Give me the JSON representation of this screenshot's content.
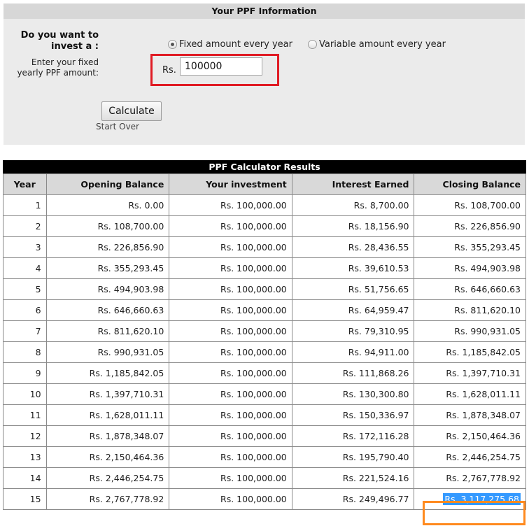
{
  "info": {
    "title": "Your PPF Information",
    "question_line1": "Do you want to",
    "question_line2": "invest a :",
    "option_fixed": "Fixed amount every year",
    "option_variable": "Variable amount every year",
    "amount_label_line1": "Enter your fixed",
    "amount_label_line2": "yearly PPF amount:",
    "currency_prefix": "Rs.",
    "amount_value": "100000",
    "calculate_label": "Calculate",
    "start_over_label": "Start Over"
  },
  "results": {
    "title": "PPF Calculator Results",
    "headers": [
      "Year",
      "Opening Balance",
      "Your investment",
      "Interest Earned",
      "Closing Balance"
    ],
    "rows": [
      [
        "1",
        "Rs. 0.00",
        "Rs. 100,000.00",
        "Rs. 8,700.00",
        "Rs. 108,700.00"
      ],
      [
        "2",
        "Rs. 108,700.00",
        "Rs. 100,000.00",
        "Rs. 18,156.90",
        "Rs. 226,856.90"
      ],
      [
        "3",
        "Rs. 226,856.90",
        "Rs. 100,000.00",
        "Rs. 28,436.55",
        "Rs. 355,293.45"
      ],
      [
        "4",
        "Rs. 355,293.45",
        "Rs. 100,000.00",
        "Rs. 39,610.53",
        "Rs. 494,903.98"
      ],
      [
        "5",
        "Rs. 494,903.98",
        "Rs. 100,000.00",
        "Rs. 51,756.65",
        "Rs. 646,660.63"
      ],
      [
        "6",
        "Rs. 646,660.63",
        "Rs. 100,000.00",
        "Rs. 64,959.47",
        "Rs. 811,620.10"
      ],
      [
        "7",
        "Rs. 811,620.10",
        "Rs. 100,000.00",
        "Rs. 79,310.95",
        "Rs. 990,931.05"
      ],
      [
        "8",
        "Rs. 990,931.05",
        "Rs. 100,000.00",
        "Rs. 94,911.00",
        "Rs. 1,185,842.05"
      ],
      [
        "9",
        "Rs. 1,185,842.05",
        "Rs. 100,000.00",
        "Rs. 111,868.26",
        "Rs. 1,397,710.31"
      ],
      [
        "10",
        "Rs. 1,397,710.31",
        "Rs. 100,000.00",
        "Rs. 130,300.80",
        "Rs. 1,628,011.11"
      ],
      [
        "11",
        "Rs. 1,628,011.11",
        "Rs. 100,000.00",
        "Rs. 150,336.97",
        "Rs. 1,878,348.07"
      ],
      [
        "12",
        "Rs. 1,878,348.07",
        "Rs. 100,000.00",
        "Rs. 172,116.28",
        "Rs. 2,150,464.36"
      ],
      [
        "13",
        "Rs. 2,150,464.36",
        "Rs. 100,000.00",
        "Rs. 195,790.40",
        "Rs. 2,446,254.75"
      ],
      [
        "14",
        "Rs. 2,446,254.75",
        "Rs. 100,000.00",
        "Rs. 221,524.16",
        "Rs. 2,767,778.92"
      ],
      [
        "15",
        "Rs. 2,767,778.92",
        "Rs. 100,000.00",
        "Rs. 249,496.77",
        "Rs. 3,117,275.68"
      ]
    ]
  },
  "colors": {
    "input_highlight": "#e01b24",
    "result_highlight": "#ff8a1e",
    "selection": "#3399ff"
  }
}
